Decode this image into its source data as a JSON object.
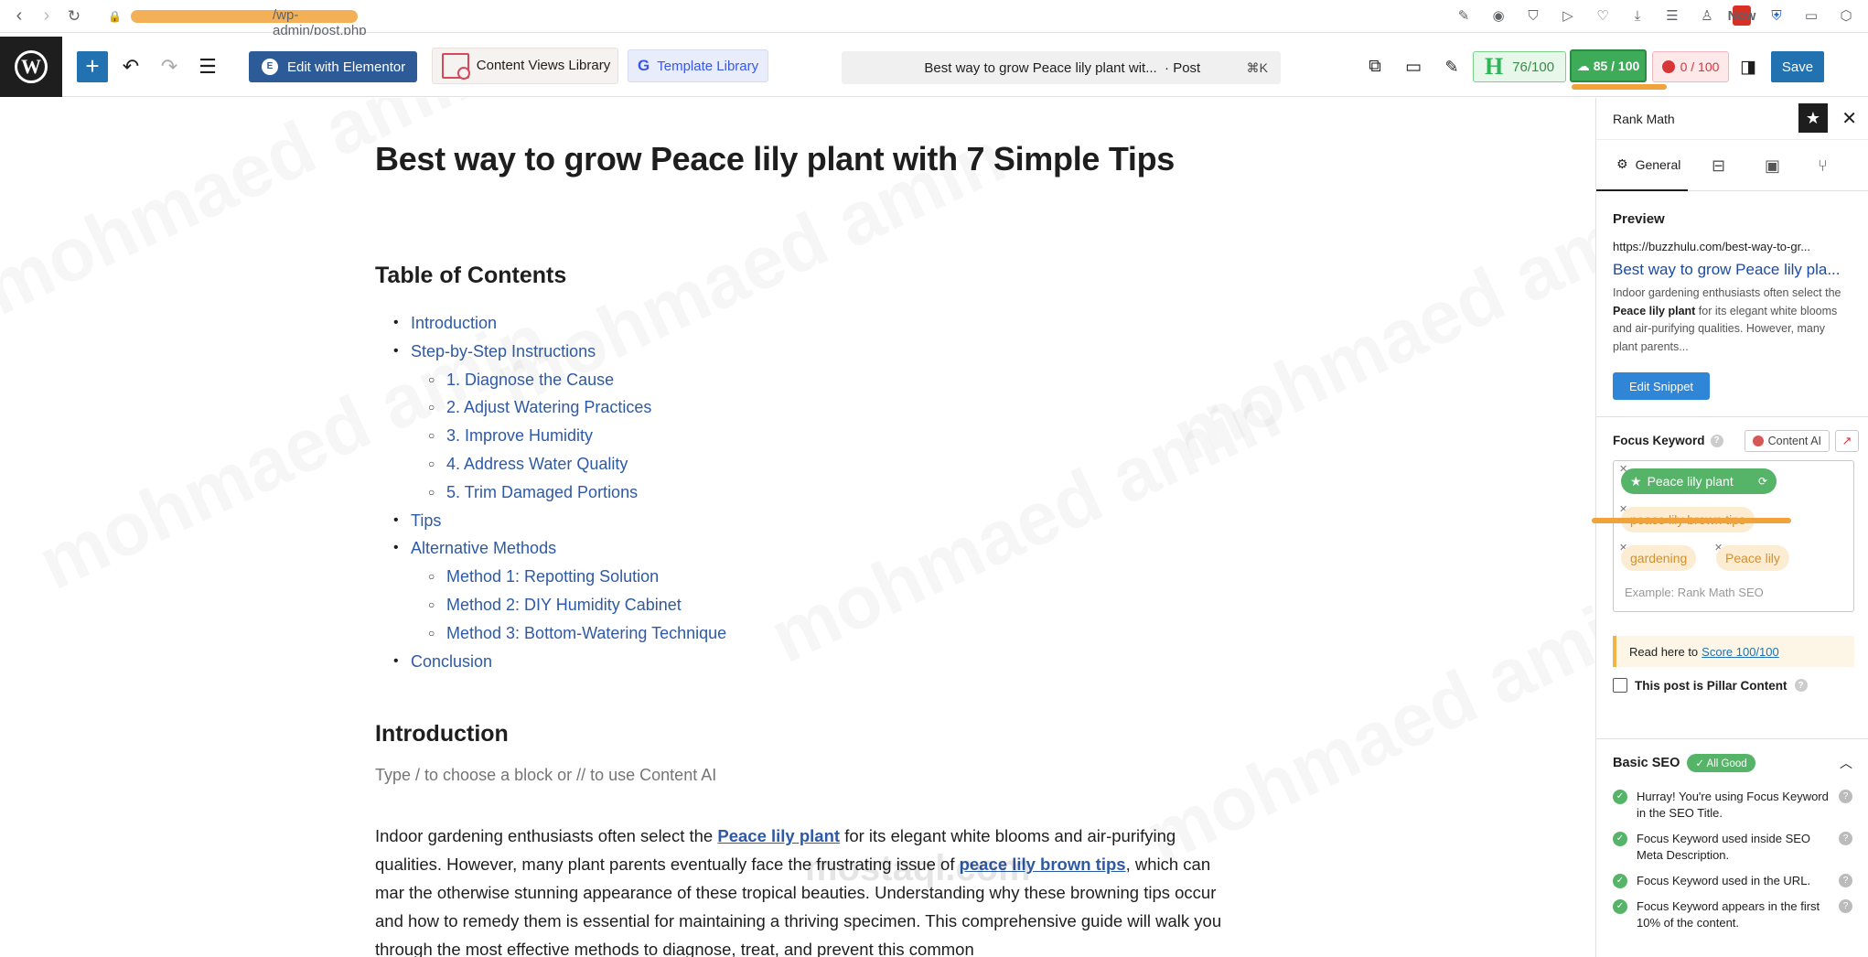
{
  "browser": {
    "url_path": "/wp-admin/post.php",
    "new_badge": "New"
  },
  "toolbar": {
    "elementor_label": "Edit with Elementor",
    "content_views_label": "Content Views Library",
    "template_library_label": "Template Library",
    "doc_title": "Best way to grow Peace lily plant wit...",
    "doc_type": "· Post",
    "shortcut": "⌘K",
    "score_h": "76/100",
    "score_rankmath": "85 / 100",
    "score_red": "0 / 100",
    "save_label": "Save"
  },
  "post": {
    "title": "Best way to grow Peace lily plant with 7 Simple Tips",
    "toc_heading": "Table of Contents",
    "toc": [
      {
        "label": "Introduction",
        "level": 1
      },
      {
        "label": "Step-by-Step Instructions",
        "level": 1
      },
      {
        "label": "1. Diagnose the Cause",
        "level": 2
      },
      {
        "label": "2. Adjust Watering Practices",
        "level": 2
      },
      {
        "label": "3. Improve Humidity",
        "level": 2
      },
      {
        "label": "4. Address Water Quality",
        "level": 2
      },
      {
        "label": "5. Trim Damaged Portions",
        "level": 2
      },
      {
        "label": "Tips",
        "level": 1
      },
      {
        "label": "Alternative Methods",
        "level": 1
      },
      {
        "label": "Method 1: Repotting Solution",
        "level": 2
      },
      {
        "label": "Method 2: DIY Humidity Cabinet",
        "level": 2
      },
      {
        "label": "Method 3: Bottom-Watering Technique",
        "level": 2
      },
      {
        "label": "Conclusion",
        "level": 1
      }
    ],
    "intro_heading": "Introduction",
    "placeholder": "Type / to choose a block or // to use Content AI",
    "paragraph": {
      "p1": "Indoor gardening enthusiasts often select the ",
      "link1": "Peace lily plant",
      "p2": " for its elegant white blooms and air-purifying qualities. However, many plant parents eventually face the frustrating issue of ",
      "link2": "peace lily brown tips",
      "p3": ", which can mar the otherwise stunning appearance of these tropical beauties. Understanding why these browning tips occur and how to remedy them is essential for maintaining a thriving specimen. This comprehensive guide will walk you through the most effective methods to diagnose, treat, and prevent this common"
    },
    "watermark_text": "mohmaed amin",
    "center_logo": "mostaql.com"
  },
  "sidebar": {
    "title": "Rank Math",
    "tab_general": "General",
    "preview_label": "Preview",
    "preview_url": "https://buzzhulu.com/best-way-to-gr...",
    "preview_title": "Best way to grow Peace lily pla...",
    "preview_desc_a": "Indoor gardening enthusiasts often select the ",
    "preview_desc_bold": "Peace lily plant",
    "preview_desc_b": " for its elegant white blooms and air-purifying qualities. However, many plant parents...",
    "edit_snippet": "Edit Snippet",
    "focus_keyword_label": "Focus Keyword",
    "content_ai_label": "Content AI",
    "keywords": [
      "Peace lily plant",
      "peace lily brown tips",
      "gardening",
      "Peace lily"
    ],
    "keyword_placeholder": "Example: Rank Math SEO",
    "read_here": "Read here to",
    "score_link": "Score 100/100",
    "pillar_label": "This post is Pillar Content",
    "basic_seo_label": "Basic SEO",
    "all_good": "✓ All Good",
    "checks": [
      "Hurray! You're using Focus Keyword in the SEO Title.",
      "Focus Keyword used inside SEO Meta Description.",
      "Focus Keyword used in the URL.",
      "Focus Keyword appears in the first 10% of the content."
    ]
  },
  "colors": {
    "accent": "#2271b1",
    "rank_green": "#3dab57",
    "link_blue": "#2e5aa5",
    "highlight_orange": "#f2a23a"
  }
}
